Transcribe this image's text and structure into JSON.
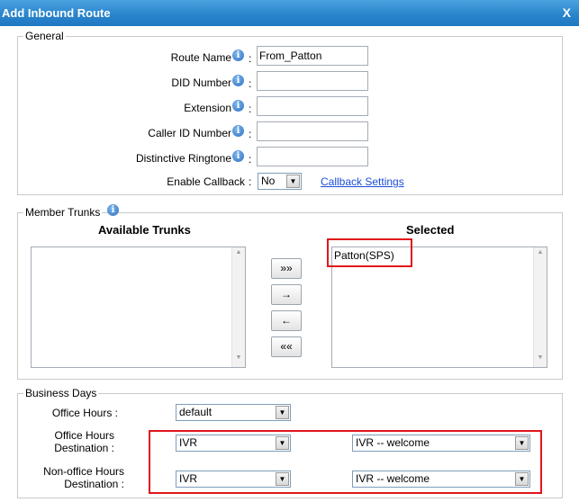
{
  "title": "Add Inbound Route",
  "close_label": "X",
  "general": {
    "legend": "General",
    "info_glyph": "i",
    "colon": ":",
    "fields": [
      {
        "label": "Route Name",
        "value": ""
      },
      {
        "label": "DID Number",
        "value": ""
      },
      {
        "label": "Extension",
        "value": ""
      },
      {
        "label": "Caller ID Number",
        "value": ""
      },
      {
        "label": "Distinctive Ringtone",
        "value": ""
      }
    ],
    "route_name_value": "From_Patton",
    "callback_label": "Enable Callback",
    "callback_value": "No",
    "callback_link": "Callback Settings"
  },
  "trunks": {
    "legend": "Member Trunks",
    "available_header": "Available Trunks",
    "selected_header": "Selected",
    "selected_items": [
      "Patton(SPS)"
    ],
    "buttons": {
      "add_all": "»»",
      "add": "→",
      "remove": "←",
      "remove_all": "««"
    }
  },
  "business": {
    "legend": "Business Days",
    "office_hours_label": "Office Hours",
    "office_hours_value": "default",
    "office_dest_label_1": "Office Hours",
    "office_dest_label_2": "Destination",
    "office_dest_type": "IVR",
    "office_dest_target": "IVR -- welcome",
    "nonoffice_dest_label_1": "Non-office Hours",
    "nonoffice_dest_label_2": "Destination",
    "nonoffice_dest_type": "IVR",
    "nonoffice_dest_target": "IVR -- welcome"
  },
  "colors": {
    "title_bar": "#2a85cc",
    "highlight": "#e1161b",
    "link": "#1a4ed8"
  },
  "icons": {
    "info": "info-icon",
    "dropdown": "chevron-down-icon"
  }
}
